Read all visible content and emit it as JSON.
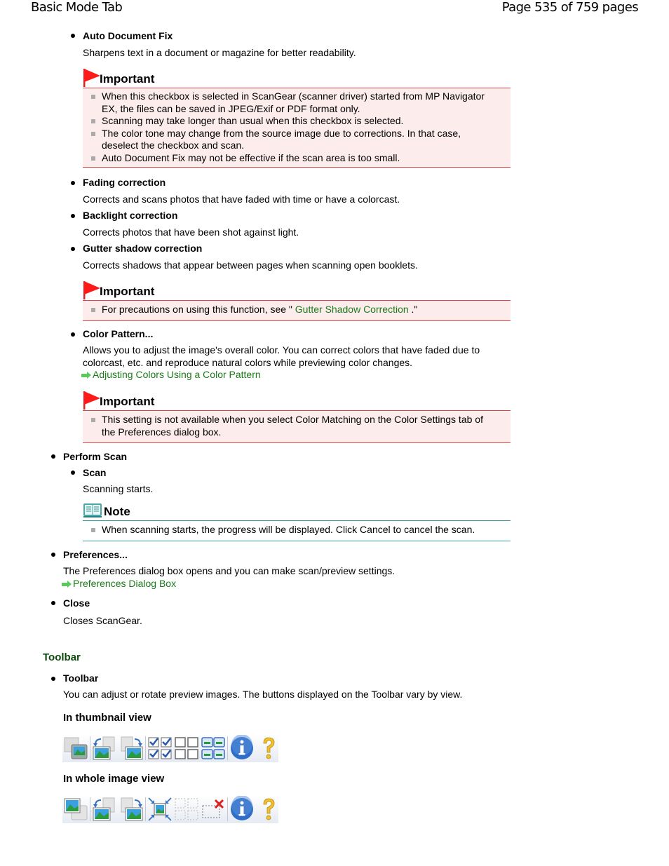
{
  "header": {
    "title": "Basic Mode Tab",
    "page_indicator": "Page 535 of 759 pages"
  },
  "auto_document_fix": {
    "label": "Auto Document Fix",
    "description": "Sharpens text in a document or magazine for better readability.",
    "important": {
      "title": "Important",
      "items": [
        "When this checkbox is selected in ScanGear (scanner driver) started from MP Navigator",
        "EX, the files can be saved in JPEG/Exif or PDF format only.",
        "Scanning may take longer than usual when this checkbox is selected.",
        "The color tone may change from the source image due to corrections. In that case,",
        "deselect the checkbox and scan.",
        "Auto Document Fix may not be effective if the scan area is too small."
      ]
    }
  },
  "fading_correction": {
    "label": "Fading correction",
    "description": "Corrects and scans photos that have faded with time or have a colorcast."
  },
  "backlight_correction": {
    "label": "Backlight correction",
    "description": "Corrects photos that have been shot against light."
  },
  "gutter_shadow_correction": {
    "label": "Gutter shadow correction",
    "description": "Corrects shadows that appear between pages when scanning open booklets.",
    "important": {
      "title": "Important",
      "text_before": "For precautions on using this function, see \" ",
      "link": "Gutter Shadow Correction",
      "text_after": " .\""
    }
  },
  "color_pattern": {
    "label": "Color Pattern...",
    "description_line1": "Allows you to adjust the image's overall color. You can correct colors that have faded due to",
    "description_line2": "colorcast, etc. and reproduce natural colors while previewing color changes.",
    "link": "Adjusting Colors Using a Color Pattern",
    "important": {
      "title": "Important",
      "line1": "This setting is not available when you select Color Matching on the Color Settings tab of",
      "line2": "the Preferences dialog box."
    }
  },
  "perform_scan": {
    "label": "Perform Scan",
    "scan": {
      "label": "Scan",
      "description": "Scanning starts.",
      "note": {
        "title": "Note",
        "text": "When scanning starts, the progress will be displayed. Click Cancel to cancel the scan."
      }
    }
  },
  "preferences": {
    "label": "Preferences...",
    "description": "The Preferences dialog box opens and you can make scan/preview settings.",
    "link": "Preferences Dialog Box"
  },
  "close": {
    "label": "Close",
    "description": "Closes ScanGear."
  },
  "toolbar_section": {
    "heading": "Toolbar",
    "label": "Toolbar",
    "description": "You can adjust or rotate preview images. The buttons displayed on the Toolbar vary by view.",
    "thumbnail_view": {
      "heading": "In thumbnail view",
      "buttons": [
        "switch-view-icon",
        "rotate-left-icon",
        "rotate-right-icon",
        "check-all-icon",
        "uncheck-all-icon",
        "select-all-frames-icon",
        "info-icon",
        "help-icon"
      ]
    },
    "whole_image_view": {
      "heading": "In whole image view",
      "buttons": [
        "switch-view-icon",
        "rotate-left-icon",
        "rotate-right-icon",
        "auto-crop-icon",
        "select-all-crop-frames-icon",
        "remove-crop-frame-icon",
        "info-icon",
        "help-icon"
      ]
    }
  },
  "colors": {
    "important_border": "#dd4444",
    "important_bg": "#fdecec",
    "note_border": "#3a9a9a",
    "link": "#1a7a1a",
    "section_heading": "#0d4a0d"
  }
}
